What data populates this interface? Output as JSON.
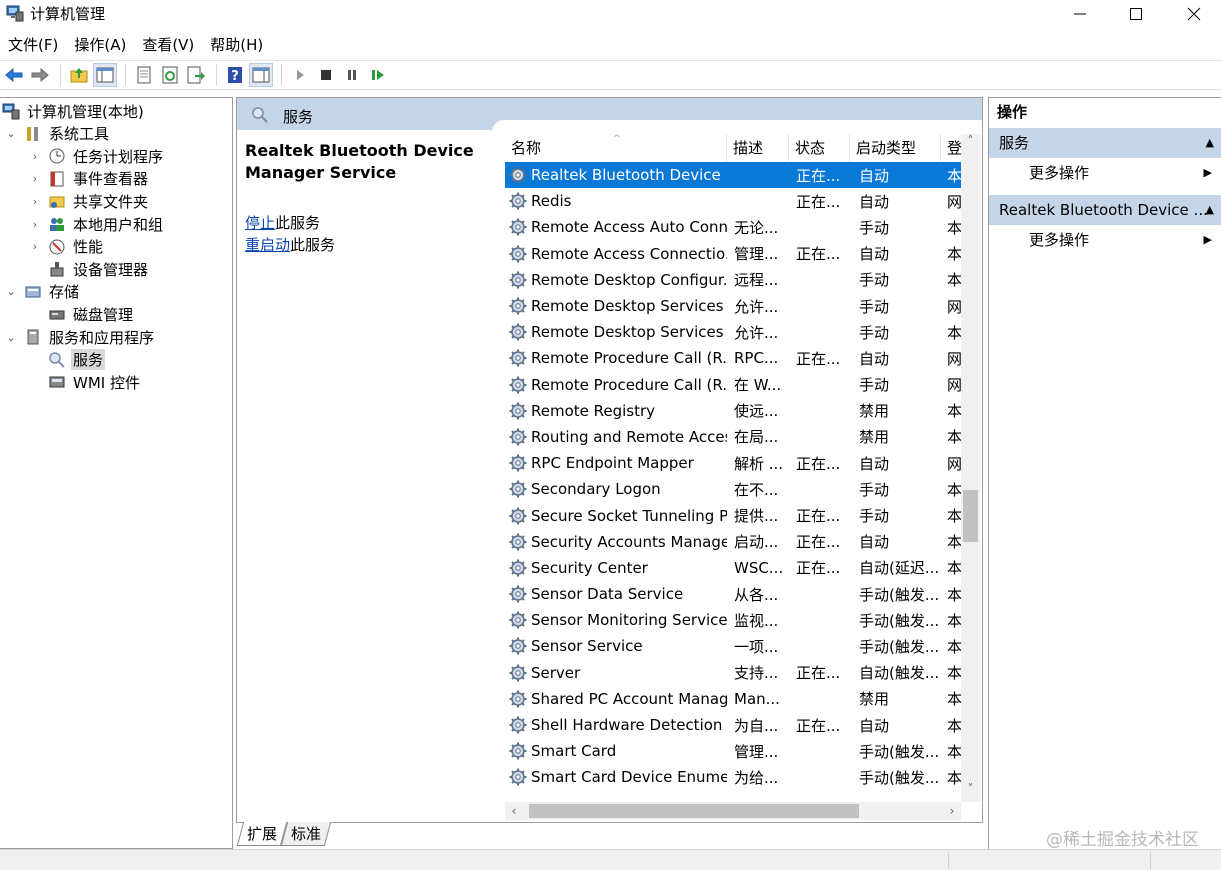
{
  "window": {
    "title": "计算机管理"
  },
  "menu": [
    "文件(F)",
    "操作(A)",
    "查看(V)",
    "帮助(H)"
  ],
  "tree": [
    {
      "label": "计算机管理(本地)",
      "indent": 0,
      "twist": "",
      "icon": "computer-mgmt-icon"
    },
    {
      "label": "系统工具",
      "indent": 1,
      "twist": "⌄",
      "icon": "tools-icon"
    },
    {
      "label": "任务计划程序",
      "indent": 2,
      "twist": "›",
      "icon": "clock-icon"
    },
    {
      "label": "事件查看器",
      "indent": 2,
      "twist": "›",
      "icon": "event-viewer-icon"
    },
    {
      "label": "共享文件夹",
      "indent": 2,
      "twist": "›",
      "icon": "shared-folder-icon"
    },
    {
      "label": "本地用户和组",
      "indent": 2,
      "twist": "›",
      "icon": "users-icon"
    },
    {
      "label": "性能",
      "indent": 2,
      "twist": "›",
      "icon": "performance-icon"
    },
    {
      "label": "设备管理器",
      "indent": 2,
      "twist": "",
      "icon": "device-manager-icon"
    },
    {
      "label": "存储",
      "indent": 1,
      "twist": "⌄",
      "icon": "storage-icon"
    },
    {
      "label": "磁盘管理",
      "indent": 2,
      "twist": "",
      "icon": "disk-icon"
    },
    {
      "label": "服务和应用程序",
      "indent": 1,
      "twist": "⌄",
      "icon": "services-apps-icon"
    },
    {
      "label": "服务",
      "indent": 2,
      "twist": "",
      "icon": "services-icon",
      "selected": true
    },
    {
      "label": "WMI 控件",
      "indent": 2,
      "twist": "",
      "icon": "wmi-icon"
    }
  ],
  "center": {
    "header": "服务",
    "selected_name": "Realtek Bluetooth Device Manager Service",
    "stop_link": "停止",
    "stop_rest": "此服务",
    "restart_link": "重启动",
    "restart_rest": "此服务",
    "columns": [
      "名称",
      "描述",
      "状态",
      "启动类型",
      "登"
    ],
    "rows": [
      [
        "Realtek Bluetooth Device ...",
        "",
        "正在...",
        "自动",
        "本"
      ],
      [
        "Redis",
        "",
        "正在...",
        "自动",
        "网"
      ],
      [
        "Remote Access Auto Conn...",
        "无论...",
        "",
        "手动",
        "本"
      ],
      [
        "Remote Access Connectio...",
        "管理...",
        "正在...",
        "自动",
        "本"
      ],
      [
        "Remote Desktop Configur...",
        "远程...",
        "",
        "手动",
        "本"
      ],
      [
        "Remote Desktop Services",
        "允许...",
        "",
        "手动",
        "网"
      ],
      [
        "Remote Desktop Services ...",
        "允许...",
        "",
        "手动",
        "本"
      ],
      [
        "Remote Procedure Call (R...",
        "RPC...",
        "正在...",
        "自动",
        "网"
      ],
      [
        "Remote Procedure Call (R...",
        "在 W...",
        "",
        "手动",
        "网"
      ],
      [
        "Remote Registry",
        "使远...",
        "",
        "禁用",
        "本"
      ],
      [
        "Routing and Remote Access",
        "在局...",
        "",
        "禁用",
        "本"
      ],
      [
        "RPC Endpoint Mapper",
        "解析 ...",
        "正在...",
        "自动",
        "网"
      ],
      [
        "Secondary Logon",
        "在不...",
        "",
        "手动",
        "本"
      ],
      [
        "Secure Socket Tunneling P...",
        "提供...",
        "正在...",
        "手动",
        "本"
      ],
      [
        "Security Accounts Manager",
        "启动...",
        "正在...",
        "自动",
        "本"
      ],
      [
        "Security Center",
        "WSC...",
        "正在...",
        "自动(延迟...",
        "本"
      ],
      [
        "Sensor Data Service",
        "从各...",
        "",
        "手动(触发...",
        "本"
      ],
      [
        "Sensor Monitoring Service",
        "监视...",
        "",
        "手动(触发...",
        "本"
      ],
      [
        "Sensor Service",
        "一项...",
        "",
        "手动(触发...",
        "本"
      ],
      [
        "Server",
        "支持...",
        "正在...",
        "自动(触发...",
        "本"
      ],
      [
        "Shared PC Account Manager",
        "Man...",
        "",
        "禁用",
        "本"
      ],
      [
        "Shell Hardware Detection",
        "为自...",
        "正在...",
        "自动",
        "本"
      ],
      [
        "Smart Card",
        "管理...",
        "",
        "手动(触发...",
        "本"
      ],
      [
        "Smart Card Device Enumer...",
        "为给...",
        "",
        "手动(触发...",
        "本"
      ]
    ],
    "tabs": [
      "扩展",
      "标准"
    ]
  },
  "actions": {
    "title": "操作",
    "sections": [
      {
        "label": "服务",
        "item": "更多操作"
      },
      {
        "label": "Realtek Bluetooth Device ...",
        "item": "更多操作"
      }
    ]
  },
  "watermark": "@稀土掘金技术社区",
  "colors": {
    "selection": "#0a78d7",
    "header_band": "#c5d5e8"
  }
}
